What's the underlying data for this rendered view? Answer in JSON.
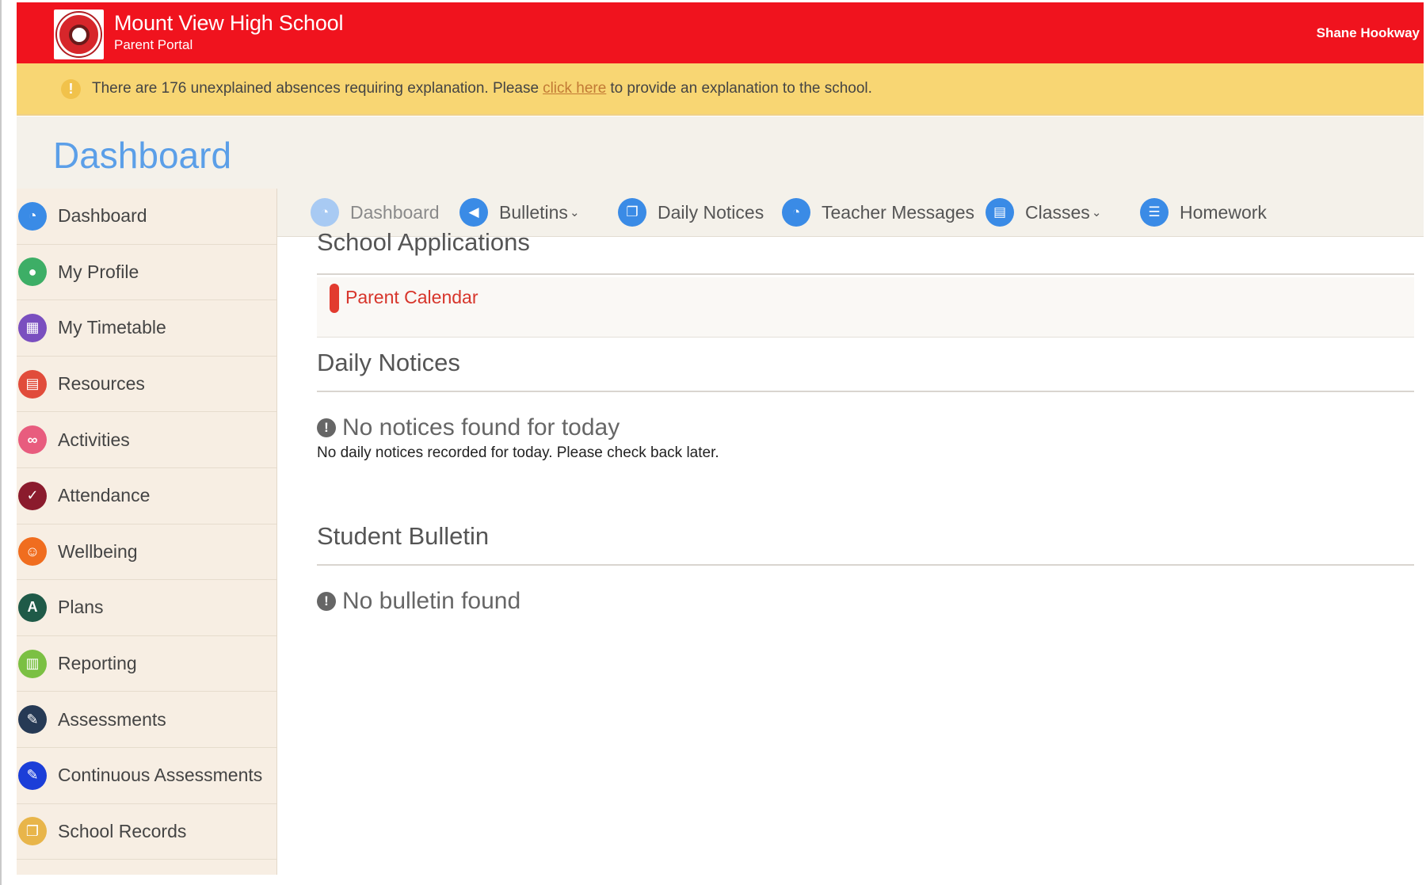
{
  "header": {
    "school_name": "Mount View High School",
    "portal_name": "Parent Portal",
    "user_name": "Shane Hookway",
    "color": "#f0131e"
  },
  "alert": {
    "text_before": "There are 176 unexplained absences requiring explanation. Please",
    "link_text": "click here",
    "text_after": "to provide an explanation to the school.",
    "color": "#f8d673"
  },
  "page": {
    "title": "Dashboard"
  },
  "sidebar": {
    "items": [
      {
        "label": "Dashboard",
        "icon": "dashboard-icon",
        "color": "#3a8be6",
        "glyph": "◔"
      },
      {
        "label": "My Profile",
        "icon": "user-icon",
        "color": "#3dae66",
        "glyph": "●"
      },
      {
        "label": "My Timetable",
        "icon": "calendar-icon",
        "color": "#7a4fbf",
        "glyph": "▦"
      },
      {
        "label": "Resources",
        "icon": "book-icon",
        "color": "#e14c3b",
        "glyph": "▤"
      },
      {
        "label": "Activities",
        "icon": "bicycle-icon",
        "color": "#e85c7e",
        "glyph": "∞"
      },
      {
        "label": "Attendance",
        "icon": "check-circle-icon",
        "color": "#8b1b2d",
        "glyph": "✓"
      },
      {
        "label": "Wellbeing",
        "icon": "smile-icon",
        "color": "#f06d1f",
        "glyph": "☺"
      },
      {
        "label": "Plans",
        "icon": "road-icon",
        "color": "#1f5a48",
        "glyph": "A"
      },
      {
        "label": "Reporting",
        "icon": "bar-chart-icon",
        "color": "#7bc043",
        "glyph": "▥"
      },
      {
        "label": "Assessments",
        "icon": "pencil-icon",
        "color": "#263a55",
        "glyph": "✎"
      },
      {
        "label": "Continuous Assessments",
        "icon": "pencil-icon",
        "color": "#1b3ed8",
        "glyph": "✎"
      },
      {
        "label": "School Records",
        "icon": "files-icon",
        "color": "#e8b54a",
        "glyph": "❐"
      }
    ]
  },
  "tabs": [
    {
      "label": "Dashboard",
      "icon": "dashboard-icon",
      "glyph": "◔",
      "dropdown": false,
      "active": true
    },
    {
      "label": "Bulletins",
      "icon": "megaphone-icon",
      "glyph": "◀",
      "dropdown": true,
      "active": false
    },
    {
      "label": "Daily Notices",
      "icon": "files-icon",
      "glyph": "❐",
      "dropdown": false,
      "active": false
    },
    {
      "label": "Teacher Messages",
      "icon": "dashboard-icon",
      "glyph": "◔",
      "dropdown": false,
      "active": false
    },
    {
      "label": "Classes",
      "icon": "book-icon",
      "glyph": "▤",
      "dropdown": true,
      "active": false
    },
    {
      "label": "Homework",
      "icon": "list-icon",
      "glyph": "☰",
      "dropdown": false,
      "active": false
    }
  ],
  "main": {
    "school_applications": {
      "title": "School Applications",
      "apps": [
        {
          "label": "Parent Calendar"
        }
      ]
    },
    "daily_notices": {
      "title": "Daily Notices",
      "empty_heading": "No notices found for today",
      "empty_text": "No daily notices recorded for today. Please check back later."
    },
    "student_bulletin": {
      "title": "Student Bulletin",
      "empty_heading": "No bulletin found"
    },
    "empty_icon_glyph": "!"
  }
}
